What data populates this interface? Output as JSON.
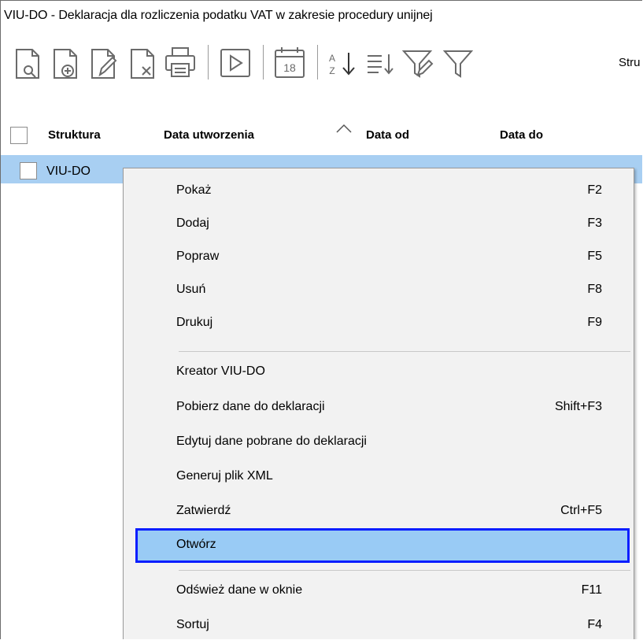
{
  "window": {
    "title": "VIU-DO - Deklaracja dla rozliczenia podatku VAT w zakresie procedury unijnej"
  },
  "toolbar": {
    "icons": [
      "preview-icon",
      "add-icon",
      "edit-icon",
      "delete-icon",
      "print-icon",
      "play-icon",
      "calendar-icon",
      "sort-az-icon",
      "sort-list-icon",
      "filter-edit-icon",
      "filter-icon"
    ],
    "calendar_day": "18",
    "sort_a": "A",
    "sort_z": "Z",
    "truncated_label": "Stru"
  },
  "table": {
    "columns": [
      "Struktura",
      "Data utworzenia",
      "Data od",
      "Data do"
    ],
    "sorted_column": "Data od",
    "rows": [
      {
        "struktura": "VIU-DO"
      }
    ]
  },
  "context_menu": {
    "groups": [
      [
        {
          "label": "Pokaż",
          "shortcut": "F2"
        },
        {
          "label": "Dodaj",
          "shortcut": "F3"
        },
        {
          "label": "Popraw",
          "shortcut": "F5"
        },
        {
          "label": "Usuń",
          "shortcut": "F8"
        },
        {
          "label": "Drukuj",
          "shortcut": "F9"
        }
      ],
      [
        {
          "label": "Kreator VIU-DO",
          "shortcut": ""
        },
        {
          "label": "Pobierz dane do deklaracji",
          "shortcut": "Shift+F3"
        },
        {
          "label": "Edytuj dane pobrane do deklaracji",
          "shortcut": ""
        },
        {
          "label": "Generuj plik XML",
          "shortcut": ""
        },
        {
          "label": "Zatwierdź",
          "shortcut": "Ctrl+F5"
        },
        {
          "label": "Otwórz",
          "shortcut": ""
        }
      ],
      [
        {
          "label": "Odśwież dane w oknie",
          "shortcut": "F11"
        },
        {
          "label": "Sortuj",
          "shortcut": "F4"
        }
      ]
    ],
    "highlighted": "Otwórz"
  },
  "colors": {
    "selection": "#a8cff2",
    "menu_background": "#f2f2f2",
    "highlight_fill": "#99cbf5",
    "highlight_border": "#0a1eff"
  }
}
